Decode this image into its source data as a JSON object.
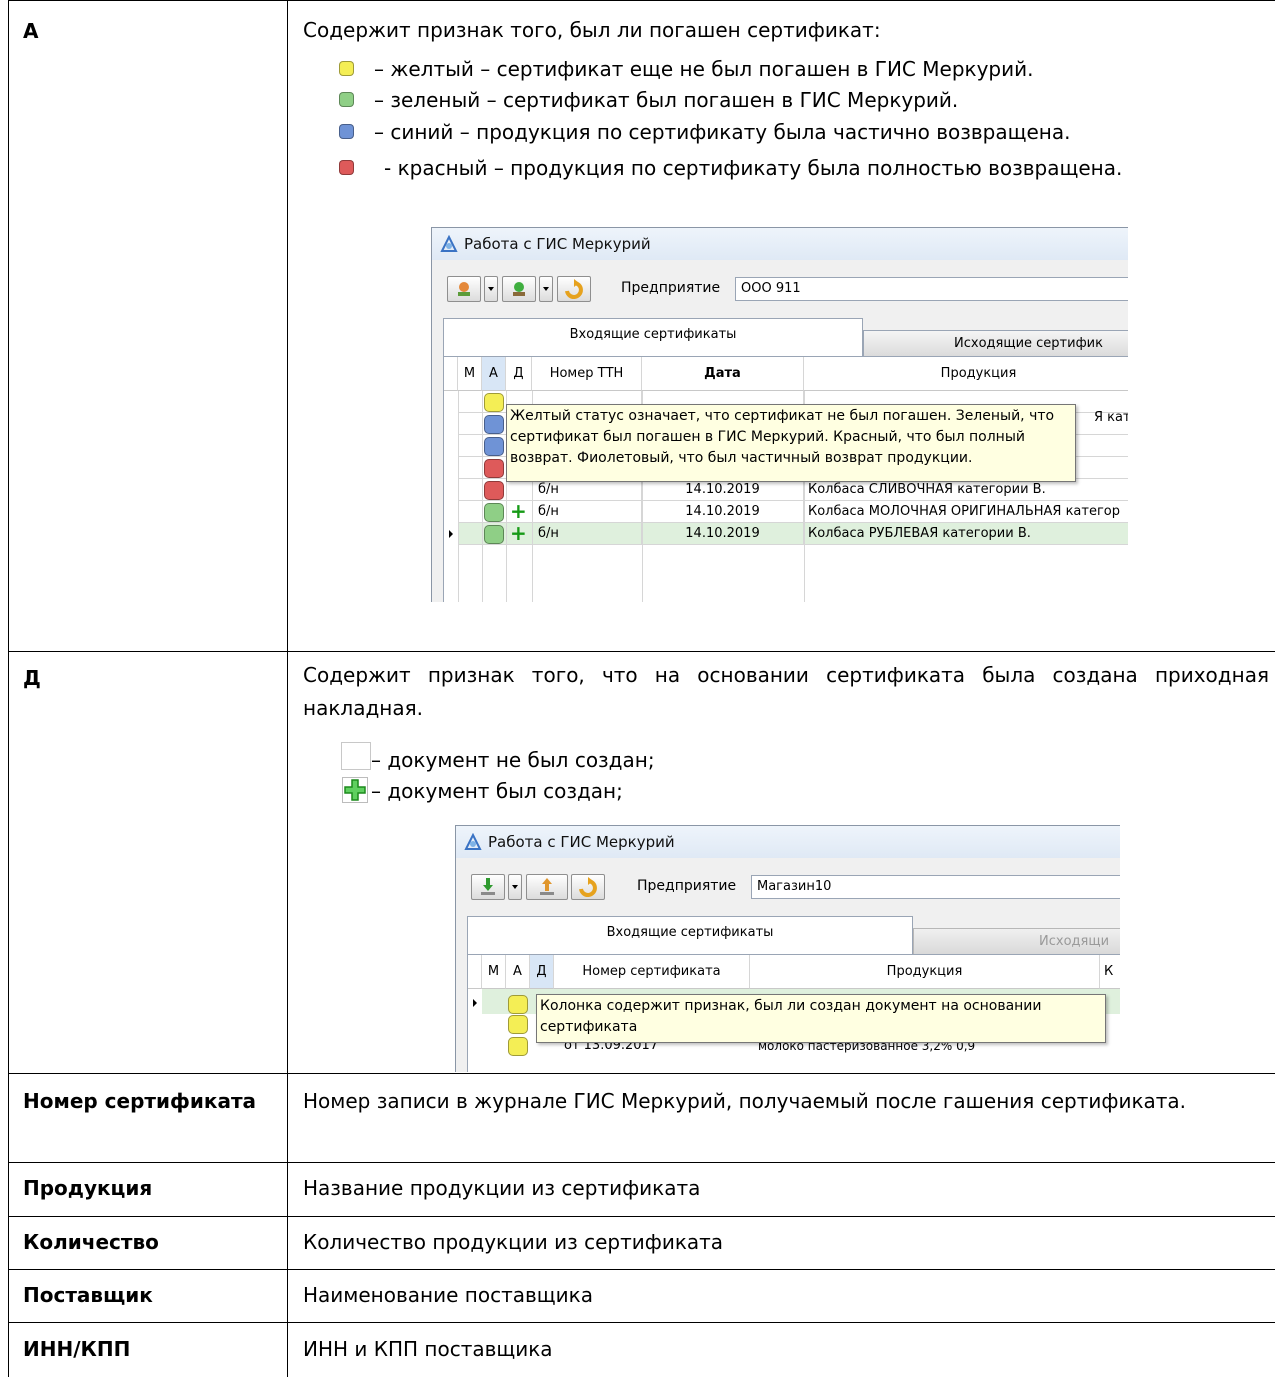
{
  "colors": {
    "yellow": "#f4ee55",
    "green": "#8fcf86",
    "blue": "#6f93d6",
    "red": "#de5a5a",
    "row_highlight": "#dff0dd"
  },
  "rows": {
    "a": {
      "term": "А",
      "intro": "Содержит признак того, был ли погашен сертификат:",
      "legend": [
        {
          "color": "yellow",
          "text": "– желтый – сертификат еще не был погашен в ГИС Меркурий."
        },
        {
          "color": "green",
          "text": "– зеленый – сертификат был погашен в ГИС Меркурий."
        },
        {
          "color": "blue",
          "text": "– синий – продукция по сертификату была частично возвращена."
        },
        {
          "color": "red",
          "text": "- красный – продукция по сертификату была полностью возвращена."
        }
      ]
    },
    "d": {
      "term": "Д",
      "intro": "Содержит признак того, что на основании сертификата была создана приходная накладная.",
      "legend": [
        {
          "icon": "empty-box-icon",
          "text": "– документ не был создан;"
        },
        {
          "icon": "green-plus-icon",
          "text": "– документ был создан;"
        }
      ]
    },
    "number": {
      "term": "Номер сертификата",
      "desc": "Номер записи в журнале ГИС Меркурий, получаемый после гашения сертификата."
    },
    "product": {
      "term": "Продукция",
      "desc": "Название продукции из сертификата"
    },
    "qty": {
      "term": "Количество",
      "desc": "Количество продукции из сертификата"
    },
    "supplier": {
      "term": "Поставщик",
      "desc": "Наименование поставщика"
    },
    "inn": {
      "term": "ИНН/КПП",
      "desc": "ИНН и КПП поставщика"
    }
  },
  "window1": {
    "title": "Работа с ГИС Меркурий",
    "enterprise_label": "Предприятие",
    "enterprise_value": "ООО 911",
    "tabs": [
      "Входящие сертификаты",
      "Исходящие сертифик"
    ],
    "columns": [
      "М",
      "А",
      "Д",
      "Номер ТТН",
      "Дата",
      "Продукция"
    ],
    "tooltip": "Желтый статус означает, что сертификат не был погашен. Зеленый, что сертификат был погашен в ГИС Меркурий. Красный, что был полный возврат. Фиолетовый, что был частичный возврат продукции.",
    "peek_text": "Я категор",
    "rows": [
      {
        "status": "yellow",
        "plus": false,
        "number": "",
        "date": "",
        "product": ""
      },
      {
        "status": "blue",
        "plus": false,
        "number": "",
        "date": "",
        "product": ""
      },
      {
        "status": "blue",
        "plus": false,
        "number": "",
        "date": "",
        "product": ""
      },
      {
        "status": "red",
        "plus": false,
        "number": "",
        "date": "",
        "product": ""
      },
      {
        "status": "red",
        "plus": false,
        "number": "б/н",
        "date": "14.10.2019",
        "product": "Колбаса  СЛИВОЧНАЯ категории В."
      },
      {
        "status": "green",
        "plus": true,
        "number": "б/н",
        "date": "14.10.2019",
        "product": "Колбаса МОЛОЧНАЯ ОРИГИНАЛЬНАЯ категор"
      },
      {
        "status": "green",
        "plus": true,
        "number": "б/н",
        "date": "14.10.2019",
        "product": "Колбаса РУБЛЕВАЯ категории В."
      }
    ]
  },
  "window2": {
    "title": "Работа с ГИС Меркурий",
    "enterprise_label": "Предприятие",
    "enterprise_value": "Магазин10",
    "tabs": [
      "Входящие сертификаты",
      "Исходящи"
    ],
    "columns": [
      "М",
      "А",
      "Д",
      "Номер сертификата",
      "Продукция",
      "К"
    ],
    "tooltip": "Колонка содержит признак, был ли создан документ на основании сертификата",
    "partial_row": {
      "number": "от 13.09.2017",
      "product": "молоко пастеризованное 3,2% 0,9"
    }
  }
}
